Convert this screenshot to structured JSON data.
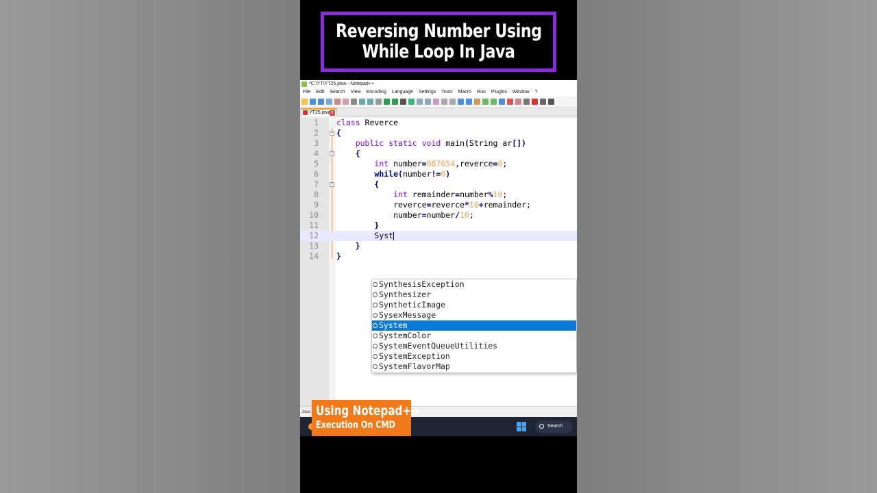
{
  "video_title": {
    "line1": "Reversing Number Using",
    "line2": "While Loop In Java"
  },
  "window": {
    "title": "*C:\\YT\\YT25.java - Notepad++"
  },
  "menu": [
    "File",
    "Edit",
    "Search",
    "View",
    "Encoding",
    "Language",
    "Settings",
    "Tools",
    "Macro",
    "Run",
    "Plugins",
    "Window",
    "?"
  ],
  "tab": {
    "label": "YT25.java",
    "close": "x"
  },
  "code_lines": [
    {
      "n": "1",
      "parts": [
        [
          "kw",
          "class"
        ],
        [
          "",
          " Reverce"
        ]
      ]
    },
    {
      "n": "2",
      "parts": [
        [
          "op",
          "{"
        ]
      ]
    },
    {
      "n": "3",
      "parts": [
        [
          "",
          "    "
        ],
        [
          "kw",
          "public static void"
        ],
        [
          "",
          " main"
        ],
        [
          "op",
          "("
        ],
        [
          "",
          "String ar"
        ],
        [
          "op",
          "[])"
        ]
      ]
    },
    {
      "n": "4",
      "parts": [
        [
          "",
          "    "
        ],
        [
          "op",
          "{"
        ]
      ]
    },
    {
      "n": "5",
      "parts": [
        [
          "",
          "        "
        ],
        [
          "kw",
          "int"
        ],
        [
          "",
          " number"
        ],
        [
          "op",
          "="
        ],
        [
          "num",
          "987654"
        ],
        [
          "",
          ",reverce"
        ],
        [
          "op",
          "="
        ],
        [
          "num",
          "0"
        ],
        [
          "",
          ";"
        ]
      ]
    },
    {
      "n": "6",
      "parts": [
        [
          "",
          "        "
        ],
        [
          "bold",
          "while"
        ],
        [
          "op",
          "("
        ],
        [
          "",
          "number"
        ],
        [
          "op",
          "!="
        ],
        [
          "num",
          "0"
        ],
        [
          "op",
          ")"
        ]
      ]
    },
    {
      "n": "7",
      "parts": [
        [
          "",
          "        "
        ],
        [
          "op",
          "{"
        ]
      ]
    },
    {
      "n": "8",
      "parts": [
        [
          "",
          "            "
        ],
        [
          "kw",
          "int"
        ],
        [
          "",
          " remainder"
        ],
        [
          "op",
          "="
        ],
        [
          "",
          "number"
        ],
        [
          "op",
          "%"
        ],
        [
          "num",
          "10"
        ],
        [
          "",
          ";"
        ]
      ]
    },
    {
      "n": "9",
      "parts": [
        [
          "",
          "            reverce"
        ],
        [
          "op",
          "="
        ],
        [
          "",
          "reverce"
        ],
        [
          "op",
          "*"
        ],
        [
          "num",
          "10"
        ],
        [
          "op",
          "+"
        ],
        [
          "",
          "remainder;"
        ]
      ]
    },
    {
      "n": "10",
      "parts": [
        [
          "",
          "            number"
        ],
        [
          "op",
          "="
        ],
        [
          "",
          "number"
        ],
        [
          "op",
          "/"
        ],
        [
          "num",
          "10"
        ],
        [
          "",
          ";"
        ]
      ]
    },
    {
      "n": "11",
      "parts": [
        [
          "",
          "        "
        ],
        [
          "op",
          "}"
        ]
      ]
    },
    {
      "n": "12",
      "parts": [
        [
          "",
          "        Syst"
        ]
      ]
    },
    {
      "n": "13",
      "parts": [
        [
          "",
          "    "
        ],
        [
          "op",
          "}"
        ]
      ]
    },
    {
      "n": "14",
      "parts": [
        [
          "op",
          "}"
        ]
      ]
    }
  ],
  "autocomplete": {
    "items": [
      "SynthesisException",
      "Synthesizer",
      "SyntheticImage",
      "SysexMessage",
      "System",
      "SystemColor",
      "SystemEventQueueUtilities",
      "SystemException",
      "SystemFlavorMap"
    ],
    "selected": "System"
  },
  "statusbar": {
    "text": "Java s"
  },
  "taskbar": {
    "search_label": "Search"
  },
  "badge": {
    "line1": "Using Notepad++",
    "line2": "Execution On CMD"
  },
  "colors": {
    "title_border": "#8a2be2",
    "badge_bg": "#f07a1a",
    "selection": "#0a78d7"
  }
}
